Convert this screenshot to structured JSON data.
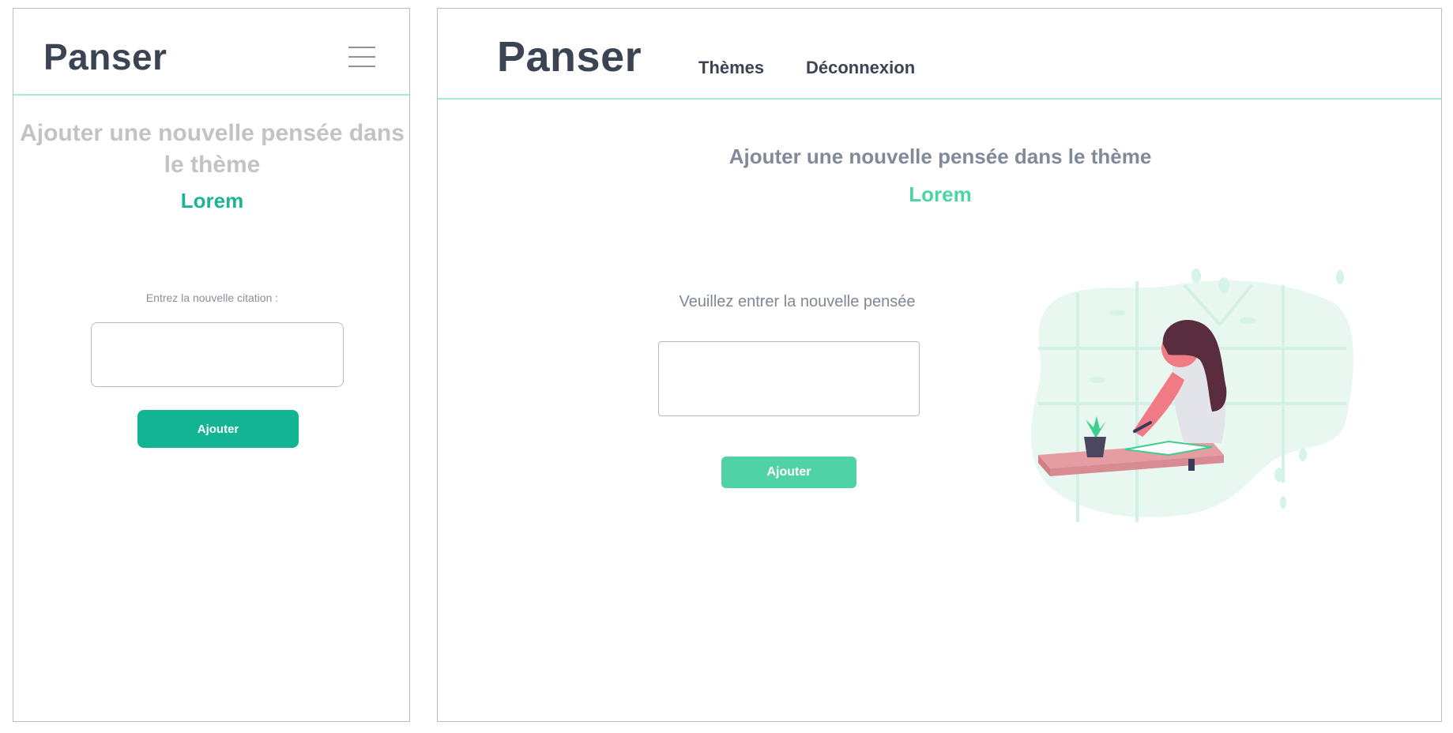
{
  "mobile": {
    "logo": "Panser",
    "menu_icon": "hamburger-menu-icon",
    "title": "Ajouter une nouvelle pensée dans le thème",
    "theme": "Lorem",
    "input_label": "Entrez la nouvelle citation :",
    "input_value": "",
    "button_label": "Ajouter"
  },
  "desktop": {
    "logo": "Panser",
    "nav": [
      {
        "label": "Thèmes"
      },
      {
        "label": "Déconnexion"
      }
    ],
    "title": "Ajouter une nouvelle pensée dans le thème",
    "theme": "Lorem",
    "input_label": "Veuillez entrer la nouvelle pensée",
    "input_value": "",
    "button_label": "Ajouter",
    "illustration": "woman-writing-at-desk-illustration"
  },
  "colors": {
    "accent": "#13b494",
    "accent_light": "#4fd2a5",
    "rule": "#a7ead7",
    "text_dark": "#3a4452",
    "text_muted": "#808a99"
  }
}
